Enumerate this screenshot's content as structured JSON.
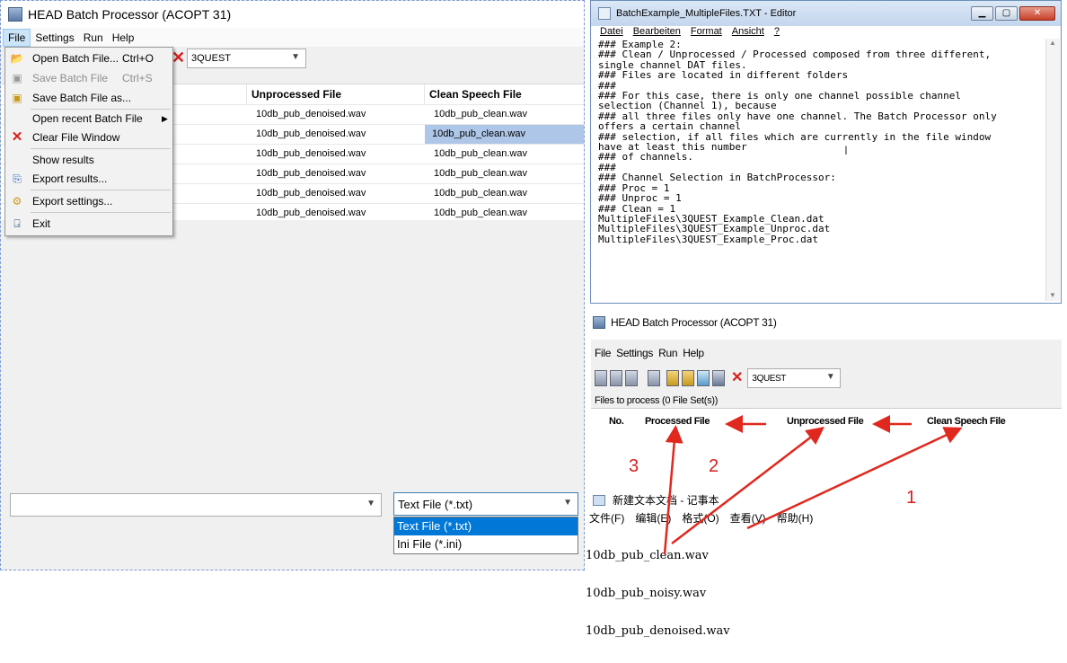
{
  "main": {
    "title": "HEAD Batch Processor (ACOPT 31)",
    "menu": [
      "File",
      "Settings",
      "Run",
      "Help"
    ],
    "toolbar_combo": "3QUEST",
    "columns": [
      "Unprocessed File",
      "Clean Speech File"
    ],
    "rows": [
      [
        "10db_pub_denoised.wav",
        "10db_pub_clean.wav"
      ],
      [
        "10db_pub_denoised.wav",
        "10db_pub_clean.wav"
      ],
      [
        "10db_pub_denoised.wav",
        "10db_pub_clean.wav"
      ],
      [
        "10db_pub_denoised.wav",
        "10db_pub_clean.wav"
      ],
      [
        "10db_pub_denoised.wav",
        "10db_pub_clean.wav"
      ],
      [
        "10db_pub_denoised.wav",
        "10db_pub_clean.wav"
      ]
    ],
    "file_type": "Text File (*.txt)",
    "file_type_options": [
      "Text File (*.txt)",
      "Ini File (*.ini)"
    ]
  },
  "file_menu": {
    "open": "Open Batch File...",
    "open_sc": "Ctrl+O",
    "save": "Save Batch File",
    "save_sc": "Ctrl+S",
    "save_as": "Save Batch File as...",
    "recent": "Open recent Batch File",
    "clear": "Clear File Window",
    "show": "Show results",
    "export_results": "Export results...",
    "export_settings": "Export settings...",
    "exit": "Exit"
  },
  "editor": {
    "title": "BatchExample_MultipleFiles.TXT - Editor",
    "menu": [
      "Datei",
      "Bearbeiten",
      "Format",
      "Ansicht",
      "?"
    ],
    "text": "### Example 2:\n### Clean / Unprocessed / Processed composed from three different,\nsingle channel DAT files.\n### Files are located in different folders\n###\n### For this case, there is only one channel possible channel\nselection (Channel 1), because\n### all three files only have one channel. The Batch Processor only\noffers a certain channel\n### selection, if all files which are currently in the file window\nhave at least this number\n### of channels.\n###\n### Channel Selection in BatchProcessor:\n### Proc = 1\n### Unproc = 1\n### Clean = 1\nMultipleFiles\\3QUEST_Example_Clean.dat\nMultipleFiles\\3QUEST_Example_Unproc.dat\nMultipleFiles\\3QUEST_Example_Proc.dat"
  },
  "inset": {
    "title": "HEAD Batch Processor (ACOPT 31)",
    "menu": [
      "File",
      "Settings",
      "Run",
      "Help"
    ],
    "combo": "3QUEST",
    "files_label": "Files to process (0 File Set(s))",
    "columns": [
      "No.",
      "Processed File",
      "Unprocessed File",
      "Clean Speech File"
    ],
    "arrow_labels": [
      "3",
      "2",
      "1"
    ],
    "notepad_title": "新建文本文档 - 记事本",
    "notepad_menu": [
      "文件(F)",
      "编辑(E)",
      "格式(O)",
      "查看(V)",
      "帮助(H)"
    ],
    "notepad_lines": [
      "10db_pub_clean.wav",
      "10db_pub_noisy.wav",
      "10db_pub_denoised.wav"
    ]
  }
}
